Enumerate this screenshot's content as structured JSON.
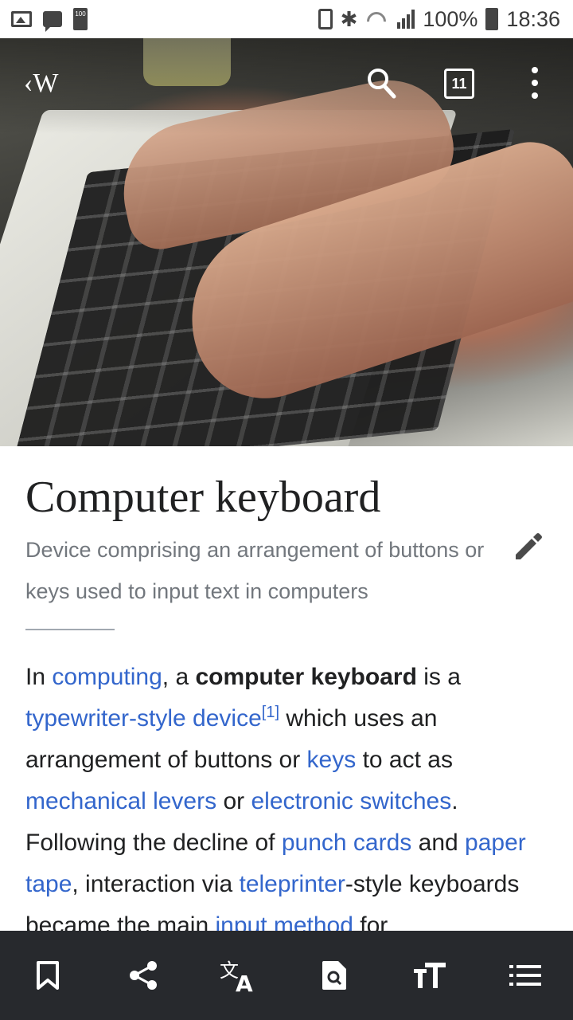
{
  "status_bar": {
    "battery_small_label": "100",
    "battery_percent": "100%",
    "time": "18:36"
  },
  "toolbar": {
    "logo_text": "‹W",
    "tabs_count": "11"
  },
  "article": {
    "title": "Computer keyboard",
    "description": "Device comprising an arrangement of buttons or keys used to input text in computers",
    "body": {
      "t1": "In ",
      "l_computing": "computing",
      "t2": ", a ",
      "b_keyboard": "computer keyboard",
      "t3": " is a ",
      "l_typewriter": "typewriter-style device",
      "ref1": "[1]",
      "t4": " which uses an arrangement of buttons or ",
      "l_keys": "keys",
      "t5": " to act as ",
      "l_levers": "mechanical levers",
      "t6": " or ",
      "l_switches": "electronic switches",
      "t7": ". Following the decline of ",
      "l_punch": "punch cards",
      "t8": " and ",
      "l_tape": "paper tape",
      "t9": ", interaction via ",
      "l_teleprinter": "teleprinter",
      "t10": "-style keyboards became the main ",
      "l_input": "input method",
      "t11": " for"
    }
  },
  "icons": {
    "status_left": [
      "gallery-icon",
      "message-icon",
      "battery-100-icon"
    ],
    "status_right": [
      "battery-lock-icon",
      "bluetooth-icon",
      "wifi-icon",
      "signal-icon",
      "battery-icon"
    ],
    "top": [
      "wikipedia-back-icon",
      "search-icon",
      "tabs-icon",
      "more-options-icon"
    ],
    "bottom": [
      "bookmark-icon",
      "share-icon",
      "translate-icon",
      "find-in-page-icon",
      "text-size-icon",
      "contents-icon"
    ]
  },
  "colors": {
    "link": "#3366cc",
    "title": "#202122",
    "description": "#72777d",
    "bottom_bar": "#27292d"
  }
}
